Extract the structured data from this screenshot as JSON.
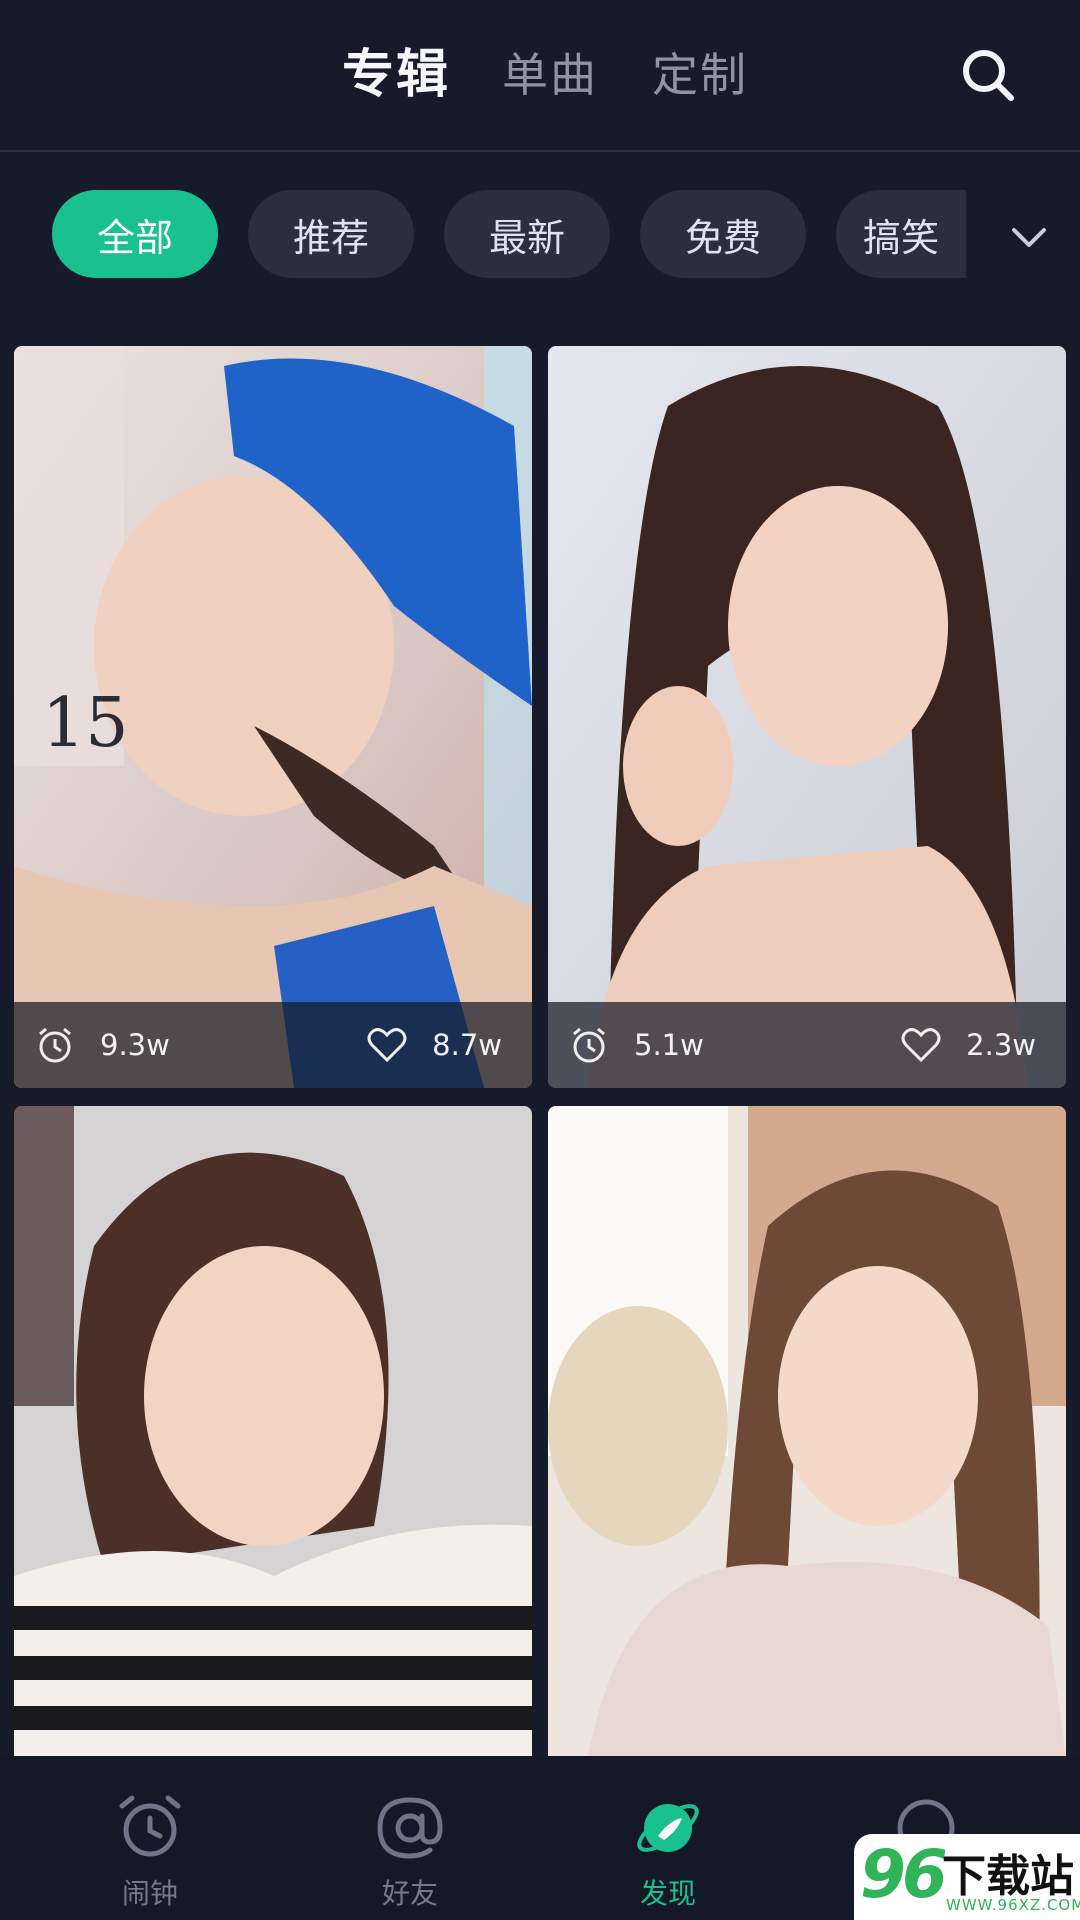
{
  "header": {
    "tabs": [
      {
        "label": "专辑",
        "active": true
      },
      {
        "label": "单曲",
        "active": false
      },
      {
        "label": "定制",
        "active": false
      }
    ],
    "search_icon": "search-icon"
  },
  "categories": {
    "items": [
      "全部",
      "推荐",
      "最新",
      "免费",
      "搞笑"
    ],
    "selected": "全部",
    "expand_icon": "chevron-down-icon"
  },
  "cards": [
    {
      "plays": "9.3w",
      "likes": "8.7w"
    },
    {
      "plays": "5.1w",
      "likes": "2.3w"
    },
    {},
    {}
  ],
  "bottom_nav": [
    {
      "label": "闹钟",
      "icon": "alarm-clock-icon",
      "active": false
    },
    {
      "label": "好友",
      "icon": "at-sign-icon",
      "active": false
    },
    {
      "label": "发现",
      "icon": "discover-planet-icon",
      "active": true
    },
    {
      "label": "",
      "icon": "profile-circle-icon",
      "active": false
    }
  ],
  "watermark": {
    "number": "96",
    "text": "下载站",
    "url": "WWW.96XZ.COM"
  },
  "colors": {
    "accent": "#19c18e",
    "background": "#161a2b",
    "chip": "#2a2f3f"
  }
}
